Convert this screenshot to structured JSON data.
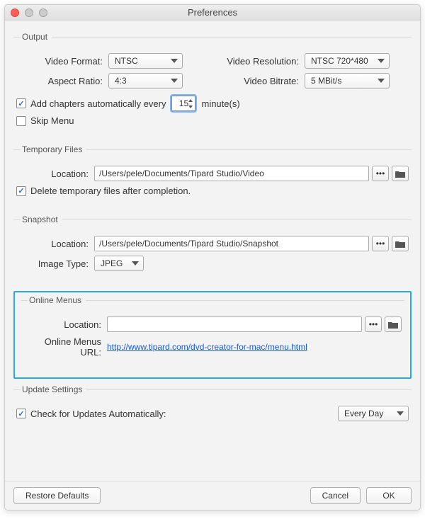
{
  "window": {
    "title": "Preferences"
  },
  "output": {
    "legend": "Output",
    "video_format_label": "Video Format:",
    "video_format_value": "NTSC",
    "video_resolution_label": "Video Resolution:",
    "video_resolution_value": "NTSC 720*480",
    "aspect_ratio_label": "Aspect Ratio:",
    "aspect_ratio_value": "4:3",
    "video_bitrate_label": "Video Bitrate:",
    "video_bitrate_value": "5 MBit/s",
    "add_chapters_checked": true,
    "add_chapters_label": "Add chapters automatically every",
    "add_chapters_value": "15",
    "add_chapters_unit": "minute(s)",
    "skip_menu_checked": false,
    "skip_menu_label": "Skip Menu"
  },
  "temp_files": {
    "legend": "Temporary Files",
    "location_label": "Location:",
    "location_value": "/Users/pele/Documents/Tipard Studio/Video",
    "delete_after_checked": true,
    "delete_after_label": "Delete temporary files after completion."
  },
  "snapshot": {
    "legend": "Snapshot",
    "location_label": "Location:",
    "location_value": "/Users/pele/Documents/Tipard Studio/Snapshot",
    "image_type_label": "Image Type:",
    "image_type_value": "JPEG"
  },
  "online_menus": {
    "legend": "Online Menus",
    "location_label": "Location:",
    "location_value": "",
    "url_label": "Online Menus URL:",
    "url_value": "http://www.tipard.com/dvd-creator-for-mac/menu.html"
  },
  "update": {
    "legend": "Update Settings",
    "check_updates_checked": true,
    "check_updates_label": "Check for Updates Automatically:",
    "freq_value": "Every Day"
  },
  "footer": {
    "restore": "Restore Defaults",
    "cancel": "Cancel",
    "ok": "OK"
  },
  "icons": {
    "browse": "•••"
  }
}
